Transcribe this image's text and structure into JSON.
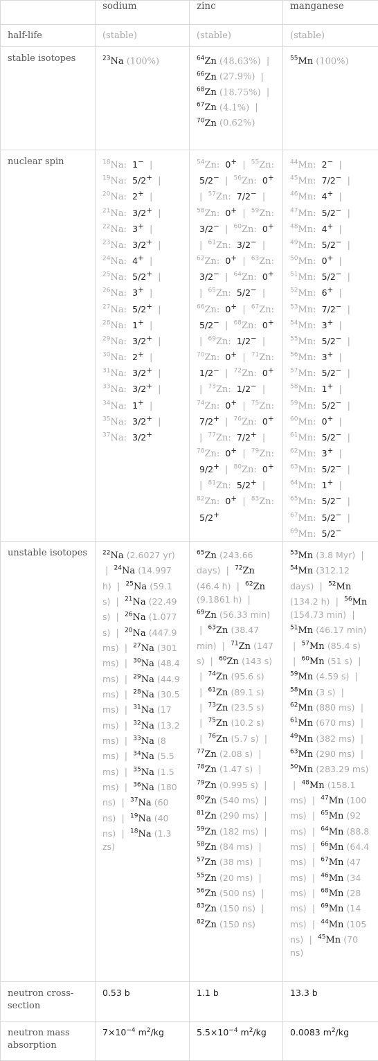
{
  "columns": [
    "",
    "sodium",
    "zinc",
    "manganese"
  ],
  "rows": {
    "half_life": {
      "label": "half-life",
      "values": [
        "(stable)",
        "(stable)",
        "(stable)"
      ]
    },
    "stable_isotopes": {
      "label": "stable isotopes",
      "values": [
        [
          {
            "mass": "23",
            "symbol": "Na",
            "abundance": "(100%)"
          }
        ],
        [
          {
            "mass": "64",
            "symbol": "Zn",
            "abundance": "(48.63%)"
          },
          {
            "mass": "66",
            "symbol": "Zn",
            "abundance": "(27.9%)"
          },
          {
            "mass": "68",
            "symbol": "Zn",
            "abundance": "(18.75%)"
          },
          {
            "mass": "67",
            "symbol": "Zn",
            "abundance": "(4.1%)"
          },
          {
            "mass": "70",
            "symbol": "Zn",
            "abundance": "(0.62%)"
          }
        ],
        [
          {
            "mass": "55",
            "symbol": "Mn",
            "abundance": "(100%)"
          }
        ]
      ]
    },
    "nuclear_spin": {
      "label": "nuclear spin",
      "values": [
        [
          {
            "mass": "18",
            "symbol": "Na",
            "spin": "1",
            "parity": "−"
          },
          {
            "mass": "19",
            "symbol": "Na",
            "spin": "5/2",
            "parity": "+"
          },
          {
            "mass": "20",
            "symbol": "Na",
            "spin": "2",
            "parity": "+"
          },
          {
            "mass": "21",
            "symbol": "Na",
            "spin": "3/2",
            "parity": "+"
          },
          {
            "mass": "22",
            "symbol": "Na",
            "spin": "3",
            "parity": "+"
          },
          {
            "mass": "23",
            "symbol": "Na",
            "spin": "3/2",
            "parity": "+"
          },
          {
            "mass": "24",
            "symbol": "Na",
            "spin": "4",
            "parity": "+"
          },
          {
            "mass": "25",
            "symbol": "Na",
            "spin": "5/2",
            "parity": "+"
          },
          {
            "mass": "26",
            "symbol": "Na",
            "spin": "3",
            "parity": "+"
          },
          {
            "mass": "27",
            "symbol": "Na",
            "spin": "5/2",
            "parity": "+"
          },
          {
            "mass": "28",
            "symbol": "Na",
            "spin": "1",
            "parity": "+"
          },
          {
            "mass": "29",
            "symbol": "Na",
            "spin": "3/2",
            "parity": "+"
          },
          {
            "mass": "30",
            "symbol": "Na",
            "spin": "2",
            "parity": "+"
          },
          {
            "mass": "31",
            "symbol": "Na",
            "spin": "3/2",
            "parity": "+"
          },
          {
            "mass": "33",
            "symbol": "Na",
            "spin": "3/2",
            "parity": "+"
          },
          {
            "mass": "34",
            "symbol": "Na",
            "spin": "1",
            "parity": "+"
          },
          {
            "mass": "35",
            "symbol": "Na",
            "spin": "3/2",
            "parity": "+"
          },
          {
            "mass": "37",
            "symbol": "Na",
            "spin": "3/2",
            "parity": "+"
          }
        ],
        [
          {
            "mass": "54",
            "symbol": "Zn",
            "spin": "0",
            "parity": "+"
          },
          {
            "mass": "55",
            "symbol": "Zn",
            "spin": "5/2",
            "parity": "−"
          },
          {
            "mass": "56",
            "symbol": "Zn",
            "spin": "0",
            "parity": "+"
          },
          {
            "mass": "57",
            "symbol": "Zn",
            "spin": "7/2",
            "parity": "−"
          },
          {
            "mass": "58",
            "symbol": "Zn",
            "spin": "0",
            "parity": "+"
          },
          {
            "mass": "59",
            "symbol": "Zn",
            "spin": "3/2",
            "parity": "−"
          },
          {
            "mass": "60",
            "symbol": "Zn",
            "spin": "0",
            "parity": "+"
          },
          {
            "mass": "61",
            "symbol": "Zn",
            "spin": "3/2",
            "parity": "−"
          },
          {
            "mass": "62",
            "symbol": "Zn",
            "spin": "0",
            "parity": "+"
          },
          {
            "mass": "63",
            "symbol": "Zn",
            "spin": "3/2",
            "parity": "−"
          },
          {
            "mass": "64",
            "symbol": "Zn",
            "spin": "0",
            "parity": "+"
          },
          {
            "mass": "65",
            "symbol": "Zn",
            "spin": "5/2",
            "parity": "−"
          },
          {
            "mass": "66",
            "symbol": "Zn",
            "spin": "0",
            "parity": "+"
          },
          {
            "mass": "67",
            "symbol": "Zn",
            "spin": "5/2",
            "parity": "−"
          },
          {
            "mass": "68",
            "symbol": "Zn",
            "spin": "0",
            "parity": "+"
          },
          {
            "mass": "69",
            "symbol": "Zn",
            "spin": "1/2",
            "parity": "−"
          },
          {
            "mass": "70",
            "symbol": "Zn",
            "spin": "0",
            "parity": "+"
          },
          {
            "mass": "71",
            "symbol": "Zn",
            "spin": "1/2",
            "parity": "−"
          },
          {
            "mass": "72",
            "symbol": "Zn",
            "spin": "0",
            "parity": "+"
          },
          {
            "mass": "73",
            "symbol": "Zn",
            "spin": "1/2",
            "parity": "−"
          },
          {
            "mass": "74",
            "symbol": "Zn",
            "spin": "0",
            "parity": "+"
          },
          {
            "mass": "75",
            "symbol": "Zn",
            "spin": "7/2",
            "parity": "+"
          },
          {
            "mass": "76",
            "symbol": "Zn",
            "spin": "0",
            "parity": "+"
          },
          {
            "mass": "77",
            "symbol": "Zn",
            "spin": "7/2",
            "parity": "+"
          },
          {
            "mass": "78",
            "symbol": "Zn",
            "spin": "0",
            "parity": "+"
          },
          {
            "mass": "79",
            "symbol": "Zn",
            "spin": "9/2",
            "parity": "+"
          },
          {
            "mass": "80",
            "symbol": "Zn",
            "spin": "0",
            "parity": "+"
          },
          {
            "mass": "81",
            "symbol": "Zn",
            "spin": "5/2",
            "parity": "+"
          },
          {
            "mass": "82",
            "symbol": "Zn",
            "spin": "0",
            "parity": "+"
          },
          {
            "mass": "83",
            "symbol": "Zn",
            "spin": "5/2",
            "parity": "+"
          }
        ],
        [
          {
            "mass": "44",
            "symbol": "Mn",
            "spin": "2",
            "parity": "−"
          },
          {
            "mass": "45",
            "symbol": "Mn",
            "spin": "7/2",
            "parity": "−"
          },
          {
            "mass": "46",
            "symbol": "Mn",
            "spin": "4",
            "parity": "+"
          },
          {
            "mass": "47",
            "symbol": "Mn",
            "spin": "5/2",
            "parity": "−"
          },
          {
            "mass": "48",
            "symbol": "Mn",
            "spin": "4",
            "parity": "+"
          },
          {
            "mass": "49",
            "symbol": "Mn",
            "spin": "5/2",
            "parity": "−"
          },
          {
            "mass": "50",
            "symbol": "Mn",
            "spin": "0",
            "parity": "+"
          },
          {
            "mass": "51",
            "symbol": "Mn",
            "spin": "5/2",
            "parity": "−"
          },
          {
            "mass": "52",
            "symbol": "Mn",
            "spin": "6",
            "parity": "+"
          },
          {
            "mass": "53",
            "symbol": "Mn",
            "spin": "7/2",
            "parity": "−"
          },
          {
            "mass": "54",
            "symbol": "Mn",
            "spin": "3",
            "parity": "+"
          },
          {
            "mass": "55",
            "symbol": "Mn",
            "spin": "5/2",
            "parity": "−"
          },
          {
            "mass": "56",
            "symbol": "Mn",
            "spin": "3",
            "parity": "+"
          },
          {
            "mass": "57",
            "symbol": "Mn",
            "spin": "5/2",
            "parity": "−"
          },
          {
            "mass": "58",
            "symbol": "Mn",
            "spin": "1",
            "parity": "+"
          },
          {
            "mass": "59",
            "symbol": "Mn",
            "spin": "5/2",
            "parity": "−"
          },
          {
            "mass": "60",
            "symbol": "Mn",
            "spin": "0",
            "parity": "+"
          },
          {
            "mass": "61",
            "symbol": "Mn",
            "spin": "5/2",
            "parity": "−"
          },
          {
            "mass": "62",
            "symbol": "Mn",
            "spin": "3",
            "parity": "+"
          },
          {
            "mass": "63",
            "symbol": "Mn",
            "spin": "5/2",
            "parity": "−"
          },
          {
            "mass": "64",
            "symbol": "Mn",
            "spin": "1",
            "parity": "+"
          },
          {
            "mass": "65",
            "symbol": "Mn",
            "spin": "5/2",
            "parity": "−"
          },
          {
            "mass": "67",
            "symbol": "Mn",
            "spin": "5/2",
            "parity": "−"
          },
          {
            "mass": "69",
            "symbol": "Mn",
            "spin": "5/2",
            "parity": "−"
          }
        ]
      ]
    },
    "unstable_isotopes": {
      "label": "unstable isotopes",
      "values": [
        [
          {
            "mass": "22",
            "symbol": "Na",
            "half_life": "(2.6027 yr)"
          },
          {
            "mass": "24",
            "symbol": "Na",
            "half_life": "(14.997 h)"
          },
          {
            "mass": "25",
            "symbol": "Na",
            "half_life": "(59.1 s)"
          },
          {
            "mass": "21",
            "symbol": "Na",
            "half_life": "(22.49 s)"
          },
          {
            "mass": "26",
            "symbol": "Na",
            "half_life": "(1.077 s)"
          },
          {
            "mass": "20",
            "symbol": "Na",
            "half_life": "(447.9 ms)"
          },
          {
            "mass": "27",
            "symbol": "Na",
            "half_life": "(301 ms)"
          },
          {
            "mass": "30",
            "symbol": "Na",
            "half_life": "(48.4 ms)"
          },
          {
            "mass": "29",
            "symbol": "Na",
            "half_life": "(44.9 ms)"
          },
          {
            "mass": "28",
            "symbol": "Na",
            "half_life": "(30.5 ms)"
          },
          {
            "mass": "31",
            "symbol": "Na",
            "half_life": "(17 ms)"
          },
          {
            "mass": "32",
            "symbol": "Na",
            "half_life": "(13.2 ms)"
          },
          {
            "mass": "33",
            "symbol": "Na",
            "half_life": "(8 ms)"
          },
          {
            "mass": "34",
            "symbol": "Na",
            "half_life": "(5.5 ms)"
          },
          {
            "mass": "35",
            "symbol": "Na",
            "half_life": "(1.5 ms)"
          },
          {
            "mass": "36",
            "symbol": "Na",
            "half_life": "(180 ns)"
          },
          {
            "mass": "37",
            "symbol": "Na",
            "half_life": "(60 ns)"
          },
          {
            "mass": "19",
            "symbol": "Na",
            "half_life": "(40 ns)"
          },
          {
            "mass": "18",
            "symbol": "Na",
            "half_life": "(1.3 zs)"
          }
        ],
        [
          {
            "mass": "65",
            "symbol": "Zn",
            "half_life": "(243.66 days)"
          },
          {
            "mass": "72",
            "symbol": "Zn",
            "half_life": "(46.4 h)"
          },
          {
            "mass": "62",
            "symbol": "Zn",
            "half_life": "(9.1861 h)"
          },
          {
            "mass": "69",
            "symbol": "Zn",
            "half_life": "(56.33 min)"
          },
          {
            "mass": "63",
            "symbol": "Zn",
            "half_life": "(38.47 min)"
          },
          {
            "mass": "71",
            "symbol": "Zn",
            "half_life": "(147 s)"
          },
          {
            "mass": "60",
            "symbol": "Zn",
            "half_life": "(143 s)"
          },
          {
            "mass": "74",
            "symbol": "Zn",
            "half_life": "(95.6 s)"
          },
          {
            "mass": "61",
            "symbol": "Zn",
            "half_life": "(89.1 s)"
          },
          {
            "mass": "73",
            "symbol": "Zn",
            "half_life": "(23.5 s)"
          },
          {
            "mass": "75",
            "symbol": "Zn",
            "half_life": "(10.2 s)"
          },
          {
            "mass": "76",
            "symbol": "Zn",
            "half_life": "(5.7 s)"
          },
          {
            "mass": "77",
            "symbol": "Zn",
            "half_life": "(2.08 s)"
          },
          {
            "mass": "78",
            "symbol": "Zn",
            "half_life": "(1.47 s)"
          },
          {
            "mass": "79",
            "symbol": "Zn",
            "half_life": "(0.995 s)"
          },
          {
            "mass": "80",
            "symbol": "Zn",
            "half_life": "(540 ms)"
          },
          {
            "mass": "81",
            "symbol": "Zn",
            "half_life": "(290 ms)"
          },
          {
            "mass": "59",
            "symbol": "Zn",
            "half_life": "(182 ms)"
          },
          {
            "mass": "58",
            "symbol": "Zn",
            "half_life": "(84 ms)"
          },
          {
            "mass": "57",
            "symbol": "Zn",
            "half_life": "(38 ms)"
          },
          {
            "mass": "55",
            "symbol": "Zn",
            "half_life": "(20 ms)"
          },
          {
            "mass": "56",
            "symbol": "Zn",
            "half_life": "(500 ns)"
          },
          {
            "mass": "83",
            "symbol": "Zn",
            "half_life": "(150 ns)"
          },
          {
            "mass": "82",
            "symbol": "Zn",
            "half_life": "(150 ns)"
          }
        ],
        [
          {
            "mass": "53",
            "symbol": "Mn",
            "half_life": "(3.8 Myr)"
          },
          {
            "mass": "54",
            "symbol": "Mn",
            "half_life": "(312.12 days)"
          },
          {
            "mass": "52",
            "symbol": "Mn",
            "half_life": "(134.2 h)"
          },
          {
            "mass": "56",
            "symbol": "Mn",
            "half_life": "(154.73 min)"
          },
          {
            "mass": "51",
            "symbol": "Mn",
            "half_life": "(46.17 min)"
          },
          {
            "mass": "57",
            "symbol": "Mn",
            "half_life": "(85.4 s)"
          },
          {
            "mass": "60",
            "symbol": "Mn",
            "half_life": "(51 s)"
          },
          {
            "mass": "59",
            "symbol": "Mn",
            "half_life": "(4.59 s)"
          },
          {
            "mass": "58",
            "symbol": "Mn",
            "half_life": "(3 s)"
          },
          {
            "mass": "62",
            "symbol": "Mn",
            "half_life": "(880 ms)"
          },
          {
            "mass": "61",
            "symbol": "Mn",
            "half_life": "(670 ms)"
          },
          {
            "mass": "49",
            "symbol": "Mn",
            "half_life": "(382 ms)"
          },
          {
            "mass": "63",
            "symbol": "Mn",
            "half_life": "(290 ms)"
          },
          {
            "mass": "50",
            "symbol": "Mn",
            "half_life": "(283.29 ms)"
          },
          {
            "mass": "48",
            "symbol": "Mn",
            "half_life": "(158.1 ms)"
          },
          {
            "mass": "47",
            "symbol": "Mn",
            "half_life": "(100 ms)"
          },
          {
            "mass": "65",
            "symbol": "Mn",
            "half_life": "(92 ms)"
          },
          {
            "mass": "64",
            "symbol": "Mn",
            "half_life": "(88.8 ms)"
          },
          {
            "mass": "66",
            "symbol": "Mn",
            "half_life": "(64.4 ms)"
          },
          {
            "mass": "67",
            "symbol": "Mn",
            "half_life": "(47 ms)"
          },
          {
            "mass": "46",
            "symbol": "Mn",
            "half_life": "(34 ms)"
          },
          {
            "mass": "68",
            "symbol": "Mn",
            "half_life": "(28 ms)"
          },
          {
            "mass": "69",
            "symbol": "Mn",
            "half_life": "(14 ms)"
          },
          {
            "mass": "44",
            "symbol": "Mn",
            "half_life": "(105 ns)"
          },
          {
            "mass": "45",
            "symbol": "Mn",
            "half_life": "(70 ns)"
          }
        ]
      ]
    },
    "neutron_cross_section": {
      "label": "neutron cross-section",
      "values": [
        "0.53 b",
        "1.1 b",
        "13.3 b"
      ]
    },
    "neutron_mass_absorption": {
      "label": "neutron mass absorption",
      "values": [
        {
          "mantissa": "7",
          "times": "×",
          "base": "10",
          "exp": "-4",
          "unit": "m",
          "unit_exp": "2",
          "unit_rest": "/kg"
        },
        {
          "mantissa": "5.5",
          "times": "×",
          "base": "10",
          "exp": "-4",
          "unit": "m",
          "unit_exp": "2",
          "unit_rest": "/kg"
        },
        {
          "mantissa": "0.0083",
          "times": "",
          "base": "",
          "exp": "",
          "unit": "m",
          "unit_exp": "2",
          "unit_rest": "/kg"
        }
      ]
    }
  },
  "separator": "|"
}
